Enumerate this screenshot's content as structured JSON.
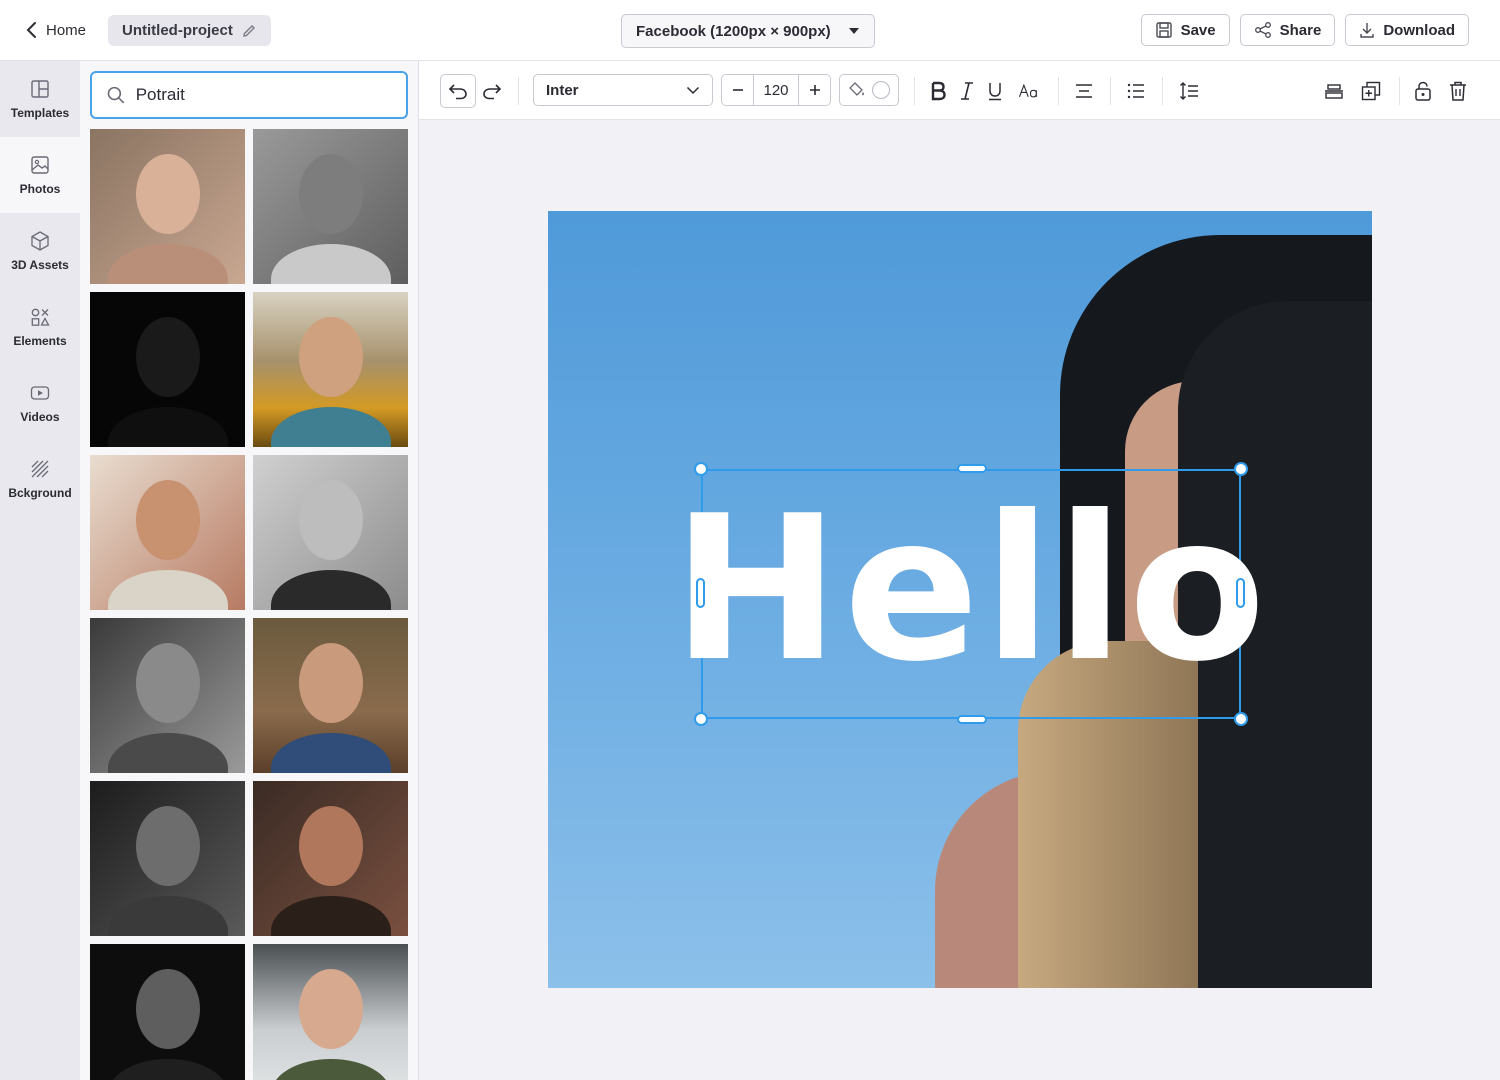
{
  "header": {
    "home_label": "Home",
    "project_name": "Untitled-project",
    "format_label": "Facebook (1200px × 900px)",
    "save_label": "Save",
    "share_label": "Share",
    "download_label": "Download"
  },
  "rail": {
    "items": [
      {
        "label": "Templates",
        "icon": "templates-icon"
      },
      {
        "label": "Photos",
        "icon": "photos-icon",
        "active": true
      },
      {
        "label": "3D Assets",
        "icon": "3d-assets-icon"
      },
      {
        "label": "Elements",
        "icon": "elements-icon"
      },
      {
        "label": "Videos",
        "icon": "videos-icon"
      },
      {
        "label": "Bckground",
        "icon": "background-icon"
      }
    ]
  },
  "photos_panel": {
    "search_value": "Potrait",
    "thumbnails": [
      {
        "name": "woman-freckles-portrait"
      },
      {
        "name": "elderly-man-bw-portrait"
      },
      {
        "name": "dark-low-key-portrait"
      },
      {
        "name": "woman-sunflowers-portrait"
      },
      {
        "name": "friends-group-portrait"
      },
      {
        "name": "curly-hair-woman-bw-portrait"
      },
      {
        "name": "girl-bw-closeup-portrait"
      },
      {
        "name": "woman-denim-jacket-portrait"
      },
      {
        "name": "woman-bw-moody-portrait"
      },
      {
        "name": "two-faces-closeup-portrait"
      },
      {
        "name": "bearded-man-bw-portrait"
      },
      {
        "name": "woman-beanie-snow-portrait"
      }
    ]
  },
  "toolbar": {
    "font_family": "Inter",
    "font_size": "120",
    "text_color": "#ffffff",
    "icons": [
      "undo-icon",
      "redo-icon",
      "fill-color-icon",
      "bold-icon",
      "italic-icon",
      "underline-icon",
      "text-case-icon",
      "align-center-icon",
      "list-icon",
      "line-height-icon",
      "align-layer-icon",
      "duplicate-icon",
      "lock-icon",
      "delete-icon"
    ]
  },
  "canvas": {
    "text_content": "Hello",
    "selection_color": "#2f9bea",
    "background_color": "#5aa3dd"
  }
}
